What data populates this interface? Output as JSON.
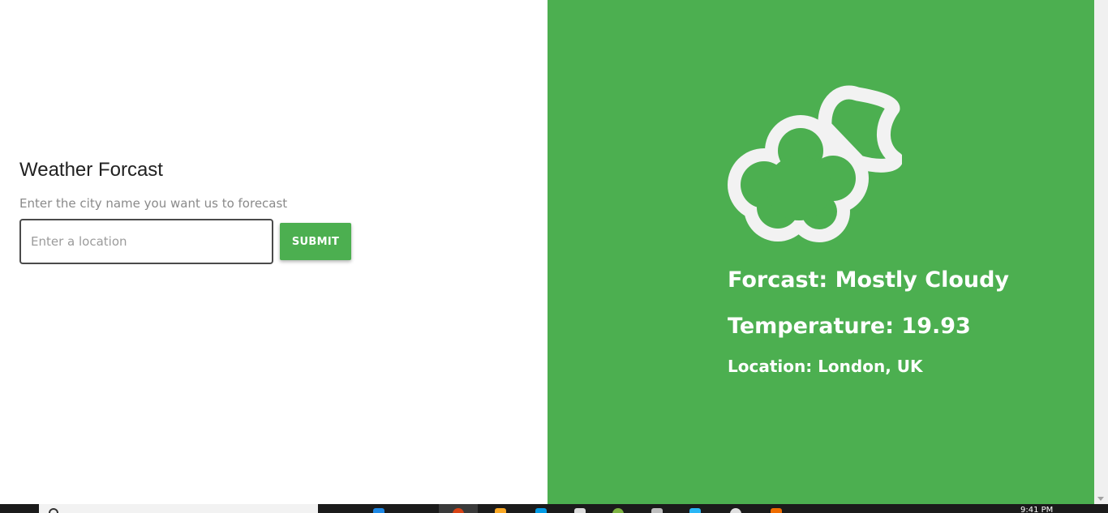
{
  "app": {
    "title": "Weather Forcast",
    "subtitle": "Enter the city name you want us to forecast"
  },
  "search": {
    "placeholder": "Enter a location",
    "value": "",
    "submit_label": "SUBMIT"
  },
  "result": {
    "icon": "partly-cloudy-night-icon",
    "forecast": "Forcast: Mostly Cloudy",
    "temperature": "Temperature: 19.93",
    "location": "Location: London, UK"
  },
  "taskbar": {
    "clock": "9:41 PM"
  },
  "colors": {
    "accent": "#4caf50",
    "icon_stroke": "#f2f2f2"
  }
}
